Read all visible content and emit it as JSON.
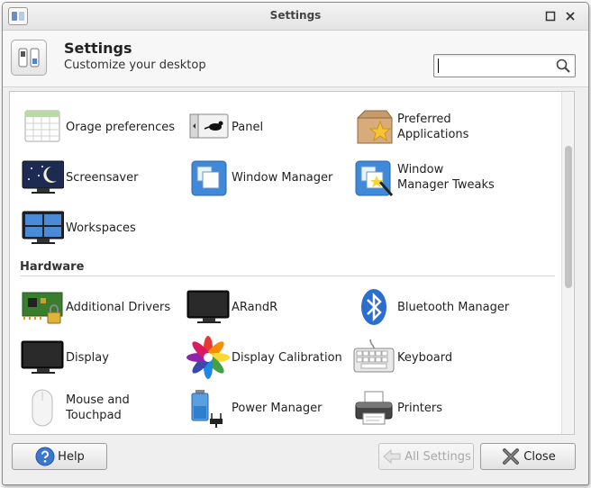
{
  "window": {
    "title": "Settings"
  },
  "header": {
    "title": "Settings",
    "subtitle": "Customize your desktop",
    "search": {
      "value": "",
      "placeholder": ""
    }
  },
  "personal": [
    {
      "label": "Orage preferences",
      "icon": "calendar-icon"
    },
    {
      "label": "Panel",
      "icon": "panel-icon"
    },
    {
      "label": "Preferred Applications",
      "icon": "preferred-applications-icon"
    },
    {
      "label": "Screensaver",
      "icon": "screensaver-icon"
    },
    {
      "label": "Window Manager",
      "icon": "window-manager-icon"
    },
    {
      "label": "Window Manager Tweaks",
      "icon": "window-manager-tweaks-icon"
    },
    {
      "label": "Workspaces",
      "icon": "workspaces-icon"
    }
  ],
  "hardware": {
    "title": "Hardware",
    "items": [
      {
        "label": "Additional Drivers",
        "icon": "additional-drivers-icon"
      },
      {
        "label": "ARandR",
        "icon": "arandr-icon"
      },
      {
        "label": "Bluetooth Manager",
        "icon": "bluetooth-icon"
      },
      {
        "label": "Display",
        "icon": "display-icon"
      },
      {
        "label": "Display Calibration",
        "icon": "display-calibration-icon"
      },
      {
        "label": "Keyboard",
        "icon": "keyboard-icon"
      },
      {
        "label": "Mouse and Touchpad",
        "icon": "mouse-icon"
      },
      {
        "label": "Power Manager",
        "icon": "power-manager-icon"
      },
      {
        "label": "Printers",
        "icon": "printer-icon"
      }
    ]
  },
  "footer": {
    "help_label": "Help",
    "all_settings_label": "All Settings",
    "close_label": "Close"
  }
}
